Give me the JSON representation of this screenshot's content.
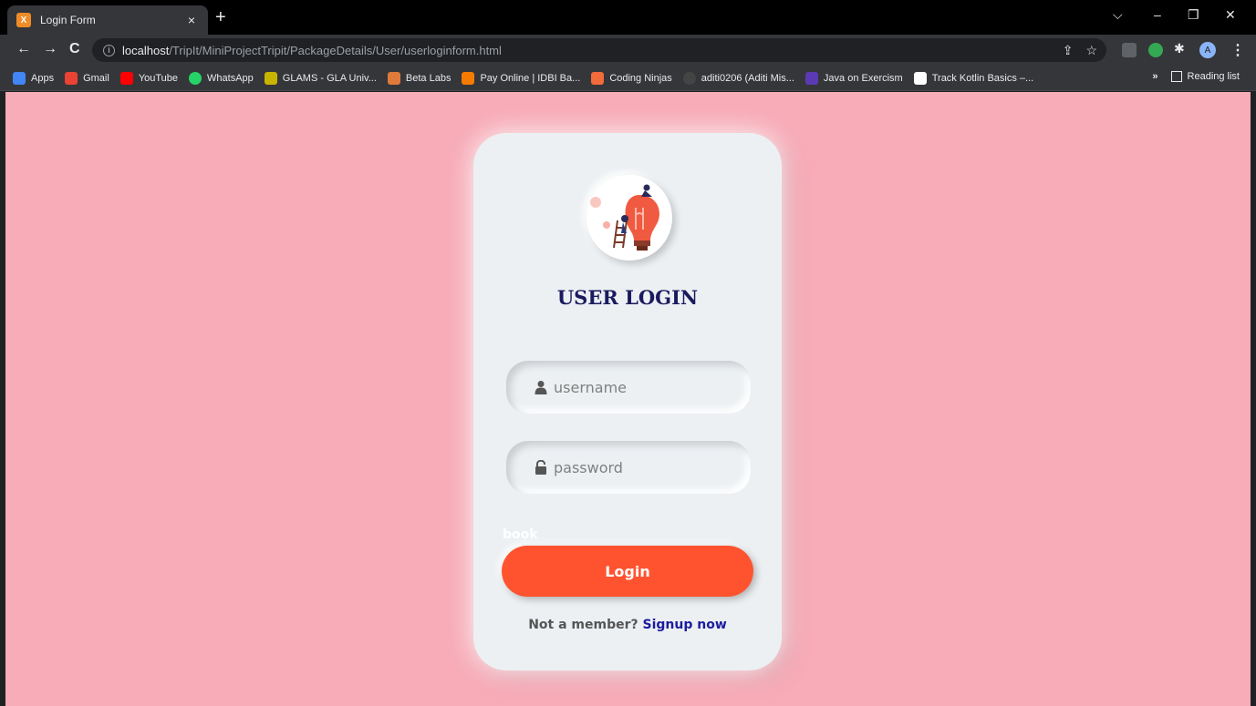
{
  "tab": {
    "title": "Login Form",
    "close": "×",
    "new": "+"
  },
  "window_controls": {
    "chevron": "⌵",
    "minimize": "–",
    "maximize": "❐",
    "close": "✕"
  },
  "toolbar": {
    "back": "←",
    "forward": "→",
    "reload": "C",
    "url_host": "localhost",
    "url_path": "/TripIt/MiniProjectTripit/PackageDetails/User/userloginform.html",
    "share": "⇪",
    "star": "☆",
    "avatar": "A",
    "menu": "⋮"
  },
  "bookmarks": [
    {
      "label": "Apps",
      "color": "#4285f4"
    },
    {
      "label": "Gmail",
      "color": "#ea4335"
    },
    {
      "label": "YouTube",
      "color": "#ff0000"
    },
    {
      "label": "WhatsApp",
      "color": "#25d366"
    },
    {
      "label": "GLAMS - GLA Univ...",
      "color": "#c8b400"
    },
    {
      "label": "Beta Labs",
      "color": "#e07a3a"
    },
    {
      "label": "Pay Online | IDBI Ba...",
      "color": "#f57c00"
    },
    {
      "label": "Coding Ninjas",
      "color": "#f26b3a"
    },
    {
      "label": "aditi0206 (Aditi Mis...",
      "color": "#444444"
    },
    {
      "label": "Java on Exercism",
      "color": "#5b3ab3"
    },
    {
      "label": "Track Kotlin Basics –...",
      "color": "#ffffff"
    }
  ],
  "bookmarks_more": "»",
  "reading_list": "Reading list",
  "login": {
    "heading": "USER LOGIN",
    "username_placeholder": "username",
    "password_placeholder": "password",
    "book_text": "book",
    "button_label": "Login",
    "signup_prompt": "Not a member? ",
    "signup_link": "Signup now"
  }
}
